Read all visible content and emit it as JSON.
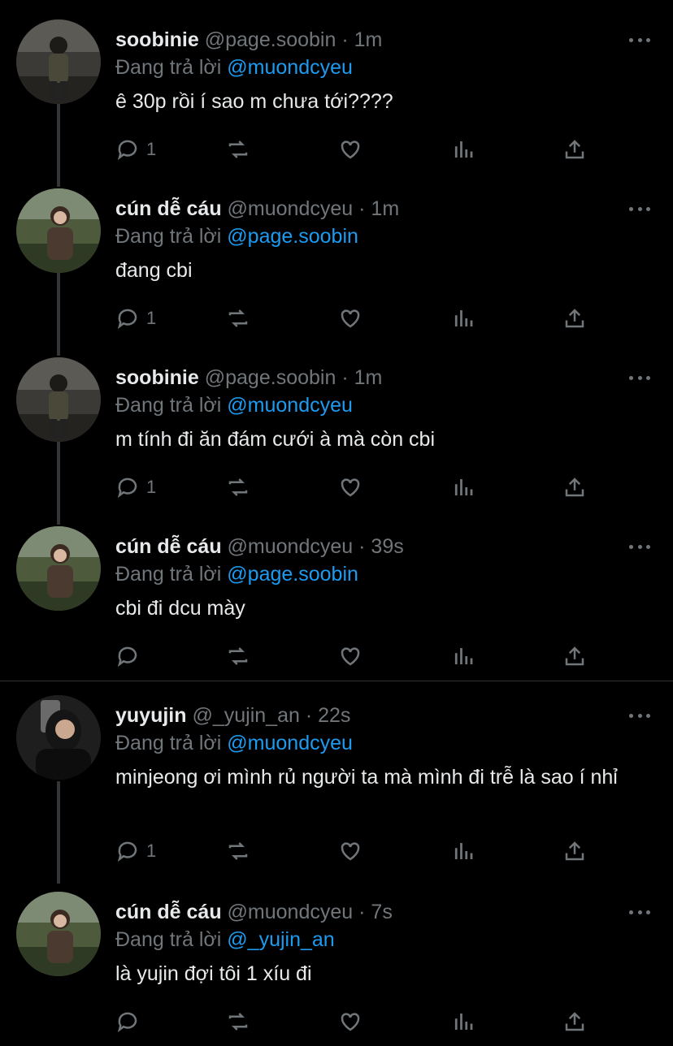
{
  "reply_label": "Đang trả lời",
  "colors": {
    "background": "#000000",
    "text": "#e7e9ea",
    "muted": "#71767b",
    "accent": "#1d9bf0"
  },
  "tweets": [
    {
      "name": "soobinie",
      "handle": "@page.soobin",
      "time": "1m",
      "reply_to": "@muondcyeu",
      "text": "ê 30p rồi í sao m chưa tới????",
      "reply_count": "1",
      "avatar": "avatar-man"
    },
    {
      "name": "cún dễ cáu",
      "handle": "@muondcyeu",
      "time": "1m",
      "reply_to": "@page.soobin",
      "text": "đang cbi",
      "reply_count": "1",
      "avatar": "avatar-child"
    },
    {
      "name": "soobinie",
      "handle": "@page.soobin",
      "time": "1m",
      "reply_to": "@muondcyeu",
      "text": "m tính đi ăn đám cưới à mà còn cbi",
      "reply_count": "1",
      "avatar": "avatar-man"
    },
    {
      "name": "cún dễ cáu",
      "handle": "@muondcyeu",
      "time": "39s",
      "reply_to": "@page.soobin",
      "text": "cbi đi dcu mày",
      "reply_count": "",
      "avatar": "avatar-child"
    },
    {
      "name": "yuyujin",
      "handle": "@_yujin_an",
      "time": "22s",
      "reply_to": "@muondcyeu",
      "text": "minjeong ơi mình rủ người ta mà mình đi trễ là sao í nhỉ",
      "reply_count": "1",
      "avatar": "avatar-woman"
    },
    {
      "name": "cún dễ cáu",
      "handle": "@muondcyeu",
      "time": "7s",
      "reply_to": "@_yujin_an",
      "text": "là yujin đợi tôi 1 xíu đi",
      "reply_count": "",
      "avatar": "avatar-child"
    }
  ]
}
